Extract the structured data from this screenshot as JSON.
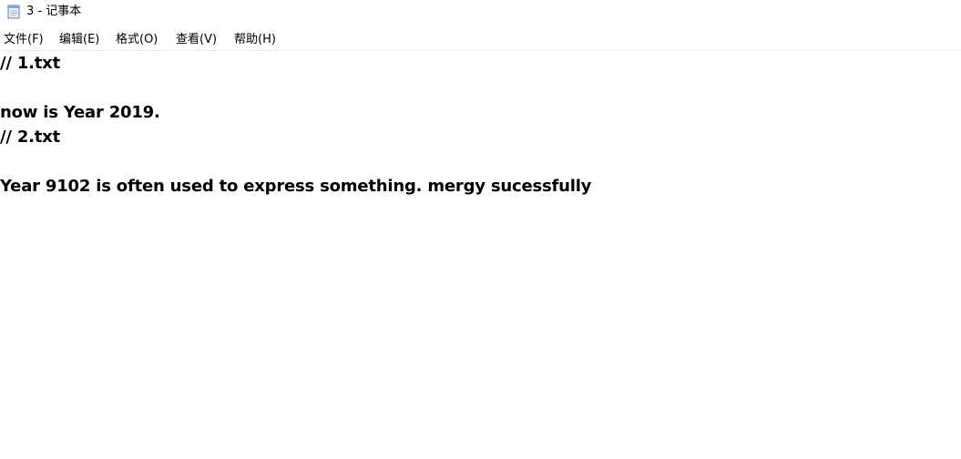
{
  "window": {
    "title": "3 - 记事本",
    "icon": "notepad-icon"
  },
  "menu": {
    "items": [
      {
        "label": "文件(F)"
      },
      {
        "label": "编辑(E)"
      },
      {
        "label": "格式(O)"
      },
      {
        "label": "查看(V)"
      },
      {
        "label": "帮助(H)"
      }
    ]
  },
  "editor": {
    "lines": [
      "// 1.txt",
      "",
      "now is Year 2019.",
      "// 2.txt",
      "",
      "Year 9102 is often used to express something. mergy sucessfully"
    ]
  }
}
